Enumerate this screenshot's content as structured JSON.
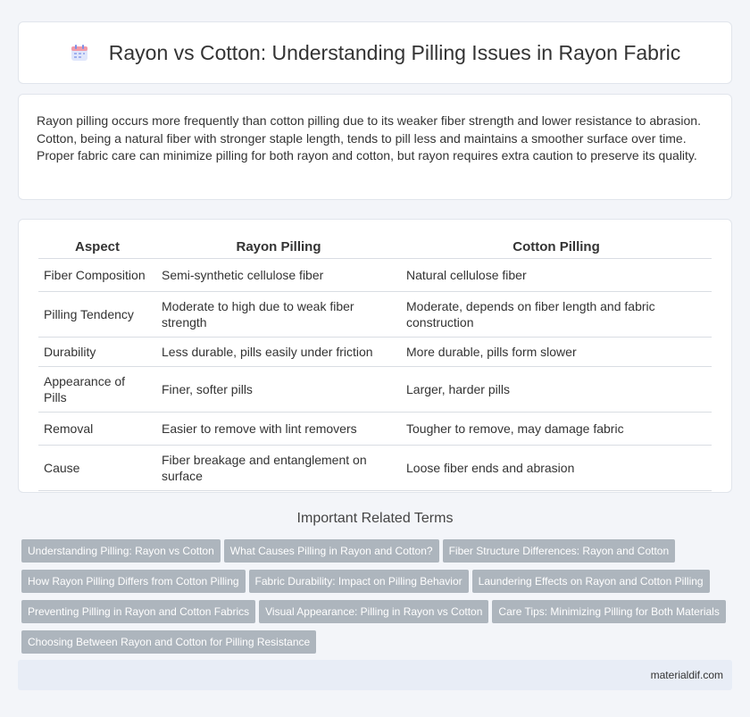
{
  "header": {
    "title": "Rayon vs Cotton: Understanding Pilling Issues in Rayon Fabric",
    "icon": "calendar-icon"
  },
  "intro": {
    "text": "Rayon pilling occurs more frequently than cotton pilling due to its weaker fiber strength and lower resistance to abrasion. Cotton, being a natural fiber with stronger staple length, tends to pill less and maintains a smoother surface over time. Proper fabric care can minimize pilling for both rayon and cotton, but rayon requires extra caution to preserve its quality."
  },
  "table": {
    "headers": [
      "Aspect",
      "Rayon Pilling",
      "Cotton Pilling"
    ],
    "rows": [
      [
        "Fiber Composition",
        "Semi-synthetic cellulose fiber",
        "Natural cellulose fiber"
      ],
      [
        "Pilling Tendency",
        "Moderate to high due to weak fiber strength",
        "Moderate, depends on fiber length and fabric construction"
      ],
      [
        "Durability",
        "Less durable, pills easily under friction",
        "More durable, pills form slower"
      ],
      [
        "Appearance of Pills",
        "Finer, softer pills",
        "Larger, harder pills"
      ],
      [
        "Removal",
        "Easier to remove with lint removers",
        "Tougher to remove, may damage fabric"
      ],
      [
        "Cause",
        "Fiber breakage and entanglement on surface",
        "Loose fiber ends and abrasion"
      ]
    ]
  },
  "related": {
    "title": "Important Related Terms",
    "tags": [
      "Understanding Pilling: Rayon vs Cotton",
      "What Causes Pilling in Rayon and Cotton?",
      "Fiber Structure Differences: Rayon and Cotton",
      "How Rayon Pilling Differs from Cotton Pilling",
      "Fabric Durability: Impact on Pilling Behavior",
      "Laundering Effects on Rayon and Cotton Pilling",
      "Preventing Pilling in Rayon and Cotton Fabrics",
      "Visual Appearance: Pilling in Rayon vs Cotton",
      "Care Tips: Minimizing Pilling for Both Materials",
      "Choosing Between Rayon and Cotton for Pilling Resistance"
    ]
  },
  "footer": {
    "site": "materialdif.com"
  },
  "colors": {
    "tag_bg": "#adb5bd",
    "footer_bg": "#e8edf6",
    "page_bg": "#f3f5f9"
  }
}
